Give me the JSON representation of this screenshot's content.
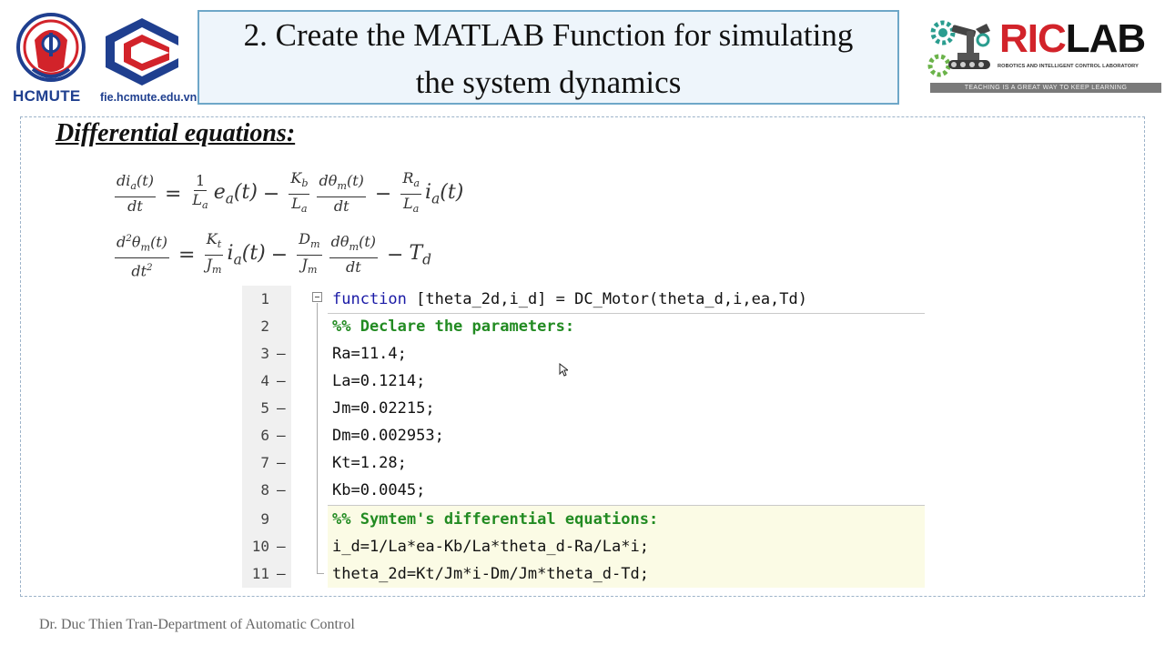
{
  "header": {
    "university_abbr": "HCMUTE",
    "faculty_url": "fie.hcmute.edu.vn",
    "title_line1": "2. Create the MATLAB Function for simulating",
    "title_line2": "the system dynamics",
    "lab_logo": {
      "ric": "RIC",
      "lab": "LAB",
      "subtitle": "ROBOTICS AND INTELLIGENT CONTROL LABORATORY",
      "tagline": "TEACHING IS A GREAT WAY TO KEEP LEARNING"
    }
  },
  "section_heading": "Differential equations:",
  "colors": {
    "title_bg": "#eef5fb",
    "title_border": "#6ea7c8",
    "brand_blue": "#1f3f8f",
    "brand_red": "#d2232a",
    "code_keyword": "#1a1aa6",
    "code_comment": "#228b22",
    "cell_highlight": "#fbfbe5"
  },
  "code": {
    "lines": [
      {
        "num": "1",
        "dash": "",
        "keyword": "function",
        "text": " [theta_2d,i_d] = DC_Motor(theta_d,i,ea,Td)"
      },
      {
        "num": "2",
        "dash": "",
        "comment": "%% Declare the parameters:"
      },
      {
        "num": "3",
        "dash": "–",
        "text": "Ra=11.4;"
      },
      {
        "num": "4",
        "dash": "–",
        "text": "La=0.1214;"
      },
      {
        "num": "5",
        "dash": "–",
        "text": "Jm=0.02215;"
      },
      {
        "num": "6",
        "dash": "–",
        "text": "Dm=0.002953;"
      },
      {
        "num": "7",
        "dash": "–",
        "text": "Kt=1.28;"
      },
      {
        "num": "8",
        "dash": "–",
        "text": "Kb=0.0045;"
      },
      {
        "num": "9",
        "dash": "",
        "comment": "%% Symtem's differential equations:"
      },
      {
        "num": "10",
        "dash": "–",
        "text": "i_d=1/La*ea-Kb/La*theta_d-Ra/La*i;"
      },
      {
        "num": "11",
        "dash": "–",
        "text": "theta_2d=Kt/Jm*i-Dm/Jm*theta_d-Td;"
      }
    ]
  },
  "footer": "Dr. Duc Thien Tran-Department of Automatic Control"
}
